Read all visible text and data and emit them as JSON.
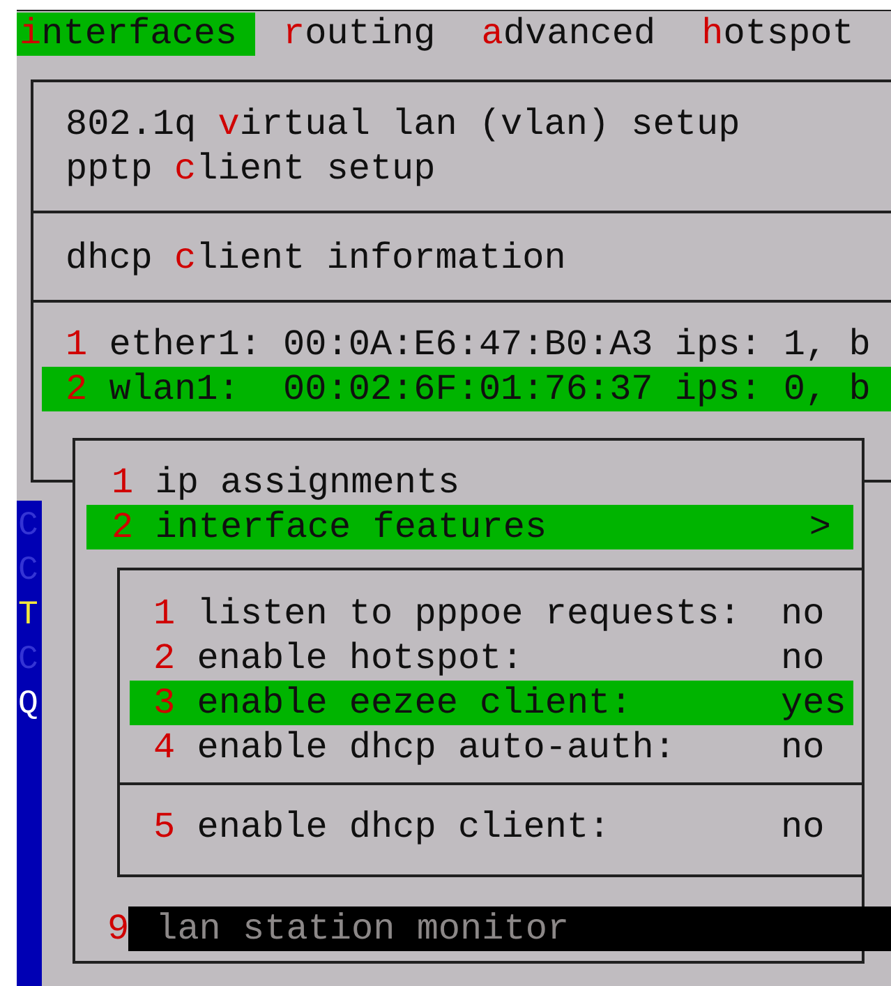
{
  "menu_bar": [
    {
      "key": "i",
      "after": "nterfaces",
      "selected": true
    },
    {
      "key": "r",
      "after": "outing",
      "selected": false
    },
    {
      "key": "a",
      "after": "dvanced",
      "selected": false
    },
    {
      "key": "h",
      "after": "otspot",
      "selected": false
    }
  ],
  "side_strip": [
    {
      "text": "C",
      "color": "#3434d4"
    },
    {
      "text": "C",
      "color": "#3434d4"
    },
    {
      "text": "T",
      "color": "#f4e83c"
    },
    {
      "text": "C",
      "color": "#3434d4"
    },
    {
      "text": "Q",
      "color": "#ffffff"
    }
  ],
  "main_menu": {
    "sections": [
      [
        {
          "before": "802.1q ",
          "key": "v",
          "after": "irtual lan (vlan) setup",
          "selected": false
        },
        {
          "before": "pptp ",
          "key": "c",
          "after": "lient setup",
          "selected": false
        }
      ],
      [
        {
          "before": "dhcp ",
          "key": "c",
          "after": "lient information",
          "selected": false
        }
      ],
      [
        {
          "key": "1",
          "after": " ether1: 00:0A:E6:47:B0:A3 ips: 1, b",
          "selected": false
        },
        {
          "key": "2",
          "after": " wlan1:  00:02:6F:01:76:37 ips: 0, b",
          "selected": true
        }
      ]
    ]
  },
  "interface_menu": {
    "items": [
      {
        "key": "1",
        "after": " ip assignments",
        "selected": false,
        "shaded": false
      },
      {
        "key": "2",
        "after": " interface features",
        "arrow": ">",
        "selected": true,
        "shaded": false
      },
      {
        "key": "9",
        "after": " lan station monitor",
        "selected": false,
        "shaded": true
      }
    ]
  },
  "features_menu": {
    "sections": [
      [
        {
          "key": "1",
          "after": " listen to pppoe requests:",
          "value": "no",
          "selected": false
        },
        {
          "key": "2",
          "after": " enable hotspot:",
          "value": "no",
          "selected": false
        },
        {
          "key": "3",
          "after": " enable eezee client:",
          "value": "yes",
          "selected": true
        },
        {
          "key": "4",
          "after": " enable dhcp auto-auth:",
          "value": "no",
          "selected": false
        }
      ],
      [
        {
          "key": "5",
          "after": " enable dhcp client:",
          "value": "no",
          "selected": false
        }
      ]
    ]
  }
}
